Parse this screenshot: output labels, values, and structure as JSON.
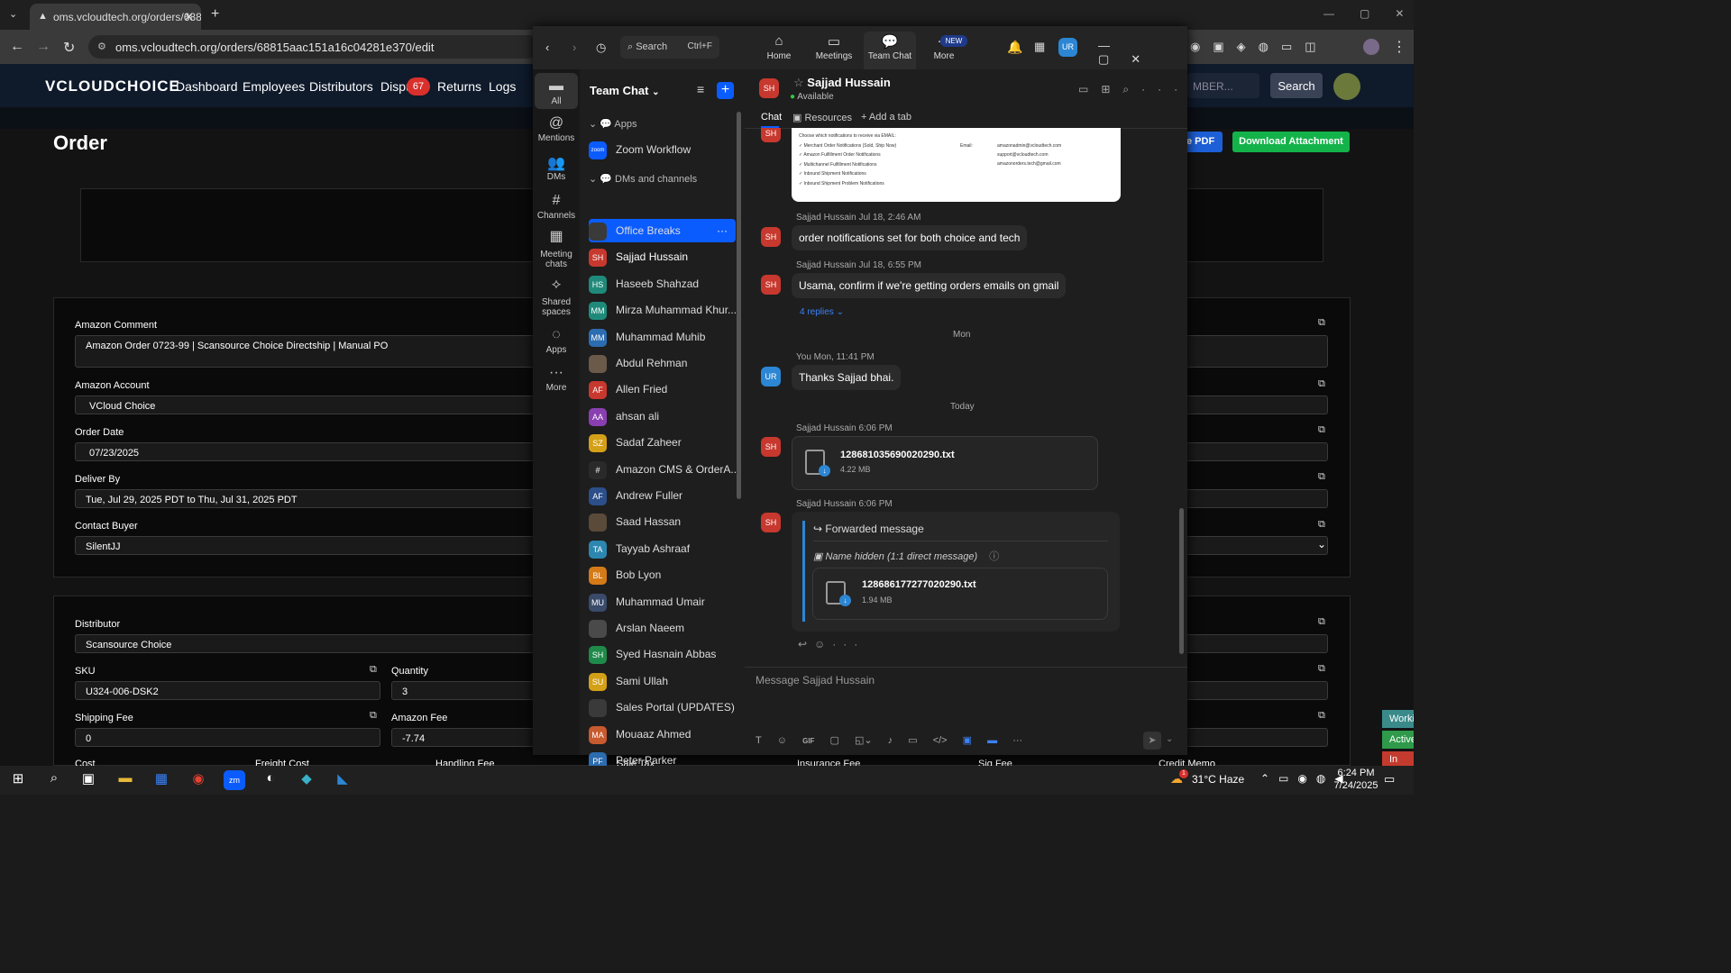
{
  "browser": {
    "tab_title": "oms.vcloudtech.org/orders/688",
    "tab_close": "✕",
    "new_tab": "+",
    "url": "oms.vcloudtech.org/orders/68815aac151a16c04281e370/edit"
  },
  "site": {
    "logo": "VCLOUDCHOICE",
    "nav": [
      "Dashboard",
      "Employees",
      "Distributors",
      "Dispu",
      "Returns",
      "Logs"
    ],
    "disputes_badge": "67",
    "search_placeholder": "MBER...",
    "search_button": "Search",
    "page_title": "Order",
    "pdf_button": "e PDF",
    "download_button": "Download Attachment",
    "fields": {
      "amazon_comment_label": "Amazon Comment",
      "amazon_comment_value": "Amazon Order 0723-99 | Scansource Choice Directship | Manual PO",
      "amazon_account_label": "Amazon Account",
      "amazon_account_value": "VCloud Choice",
      "order_date_label": "Order Date",
      "order_date_value": "07/23/2025",
      "deliver_by_label": "Deliver By",
      "deliver_by_value": "Tue, Jul 29, 2025 PDT to Thu, Jul 31, 2025 PDT",
      "contact_buyer_label": "Contact Buyer",
      "contact_buyer_value": "SilentJJ",
      "distributor_label": "Distributor",
      "distributor_value": "Scansource Choice",
      "sku_label": "SKU",
      "sku_value": "U324-006-DSK2",
      "quantity_label": "Quantity",
      "quantity_value": "3",
      "shipping_fee_label": "Shipping Fee",
      "shipping_fee_value": "0",
      "amazon_fee_label": "Amazon Fee",
      "amazon_fee_value": "-7.74",
      "bottom_labels": [
        "Cost",
        "Freight Cost",
        "Handling Fee",
        "Sale Tax",
        "Insurance Fee",
        "Sig Fee",
        "Credit Memo"
      ]
    },
    "side_tabs": [
      "Worki",
      "Active",
      "In Act"
    ]
  },
  "zoom": {
    "search_label": "Search",
    "search_shortcut": "Ctrl+F",
    "tabs": [
      {
        "label": "Home",
        "icon": "home-icon"
      },
      {
        "label": "Meetings",
        "icon": "video-icon"
      },
      {
        "label": "Team Chat",
        "icon": "chat-icon"
      },
      {
        "label": "More",
        "icon": "more-icon"
      }
    ],
    "new_badge": "NEW",
    "user_initials": "UR",
    "left_nav": [
      "All",
      "Mentions",
      "DMs",
      "Channels",
      "Meeting chats",
      "Shared spaces",
      "Apps",
      "More"
    ],
    "list_title": "Team Chat",
    "apps_header": "Apps",
    "app_item": "Zoom Workflow",
    "app_icon_text": "zoom",
    "dm_header": "DMs and channels",
    "contacts": [
      {
        "name": "Office Breaks",
        "initials": "",
        "color": "#3a3a3a"
      },
      {
        "name": "Sajjad Hussain",
        "initials": "SH",
        "color": "#c7382e"
      },
      {
        "name": "Haseeb Shahzad",
        "initials": "HS",
        "color": "#1f8a7a"
      },
      {
        "name": "Mirza Muhammad Khur...",
        "initials": "MM",
        "color": "#1f8a7a"
      },
      {
        "name": "Muhammad Muhib",
        "initials": "MM",
        "color": "#2c6cb0"
      },
      {
        "name": "Abdul Rehman",
        "initials": "",
        "color": "#6b5a4a"
      },
      {
        "name": "Allen Fried",
        "initials": "AF",
        "color": "#c7382e"
      },
      {
        "name": "ahsan ali",
        "initials": "AA",
        "color": "#8a3fb0"
      },
      {
        "name": "Sadaf Zaheer",
        "initials": "SZ",
        "color": "#d4a017"
      },
      {
        "name": "Amazon CMS & OrderA...",
        "initials": "#",
        "color": "#2a2a2a"
      },
      {
        "name": "Andrew Fuller",
        "initials": "AF",
        "color": "#2c4f8a"
      },
      {
        "name": "Saad Hassan",
        "initials": "",
        "color": "#5a4a3a"
      },
      {
        "name": "Tayyab Ashraaf",
        "initials": "TA",
        "color": "#2c86b0"
      },
      {
        "name": "Bob Lyon",
        "initials": "BL",
        "color": "#d47a17"
      },
      {
        "name": "Muhammad Umair",
        "initials": "MU",
        "color": "#3a4a6b"
      },
      {
        "name": "Arslan Naeem",
        "initials": "",
        "color": "#4a4a4a"
      },
      {
        "name": "Syed Hasnain Abbas",
        "initials": "SH",
        "color": "#1f8a4a"
      },
      {
        "name": "Sami Ullah",
        "initials": "SU",
        "color": "#d4a017"
      },
      {
        "name": "Sales Portal (UPDATES)",
        "initials": "",
        "color": "#3a3a3a"
      },
      {
        "name": "Mouaaz Ahmed",
        "initials": "MA",
        "color": "#c75a2e"
      },
      {
        "name": "Peter Parker",
        "initials": "PF",
        "color": "#2c6cb0"
      }
    ],
    "chat": {
      "contact_name": "Sajjad Hussain",
      "status": "Available",
      "contact_initials": "SH",
      "tab_chat": "Chat",
      "tab_resources": "Resources",
      "tab_add": "Add a tab",
      "screenshot_lines": [
        "Choose which notifications to receive via EMAIL:",
        "Merchant Order Notifications (Sold, Ship Now)",
        "Amazon Fulfillment Order Notifications",
        "Multichannel Fulfillment Notifications",
        "Inbound Shipment Notifications",
        "Inbound Shipment Problem Notifications"
      ],
      "screenshot_email_label": "Email:",
      "screenshot_emails": [
        "amazonadmin@vcloudtech.com",
        "support@vcloudtech.com",
        "amazonorders.tech@gmail.com"
      ],
      "messages": [
        {
          "meta": "Sajjad Hussain Jul 18, 2:46 AM",
          "text": "order notifications set for both choice and tech"
        },
        {
          "meta": "Sajjad Hussain Jul 18, 6:55 PM",
          "text": "Usama, confirm if we're getting orders emails on gmail",
          "replies": "4 replies"
        }
      ],
      "divider_mon": "Mon",
      "you_meta": "You Mon, 11:41 PM",
      "you_text": "Thanks Sajjad bhai.",
      "you_initials": "UR",
      "divider_today": "Today",
      "file1_meta": "Sajjad Hussain 6:06 PM",
      "file1_name": "128681035690020290.txt",
      "file1_size": "4.22 MB",
      "file2_meta": "Sajjad Hussain 6:06 PM",
      "forwarded_label": "Forwarded message",
      "hidden_name": "Name hidden (1:1 direct message)",
      "file2_name": "128686177277020290.txt",
      "file2_size": "1.94 MB",
      "input_placeholder": "Message Sajjad Hussain",
      "gif_label": "GIF"
    }
  },
  "taskbar": {
    "weather": "31°C  Haze",
    "time": "6:24 PM",
    "date": "7/24/2025",
    "weather_badge": "1"
  }
}
